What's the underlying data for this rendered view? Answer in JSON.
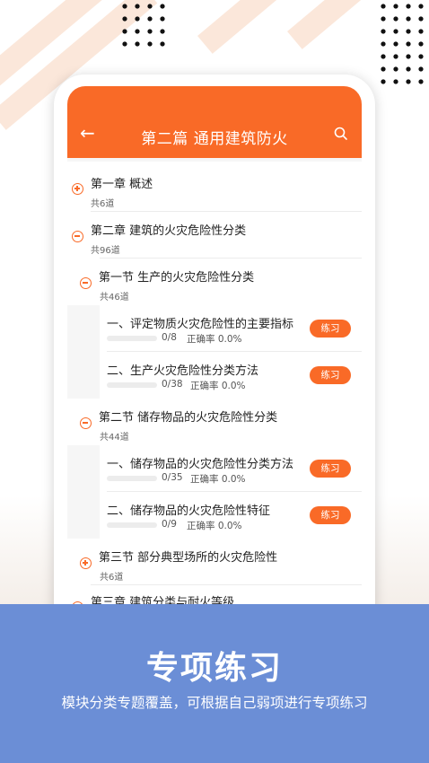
{
  "app_bar": {
    "back_icon": "arrow-left-icon",
    "title": "第二篇 通用建筑防火",
    "search_icon": "search-icon"
  },
  "colors": {
    "accent": "#f96a27",
    "banner": "#6b8ed6"
  },
  "chapters": [
    {
      "name": "第一章 概述",
      "count": "共6道",
      "expanded": false
    },
    {
      "name": "第二章 建筑的火灾危险性分类",
      "count": "共96道",
      "expanded": true
    }
  ],
  "sections": [
    {
      "name": "第一节 生产的火灾危险性分类",
      "count": "共46道",
      "expanded": true
    },
    {
      "name": "第二节 储存物品的火灾危险性分类",
      "count": "共44道",
      "expanded": true
    },
    {
      "name": "第三节 部分典型场所的火灾危险性",
      "count": "共6道",
      "expanded": false
    }
  ],
  "items": [
    {
      "name": "一、评定物质火灾危险性的主要指标",
      "progress": "0/8",
      "accuracy": "正确率 0.0%",
      "button": "练习"
    },
    {
      "name": "二、生产火灾危险性分类方法",
      "progress": "0/38",
      "accuracy": "正确率 0.0%",
      "button": "练习"
    },
    {
      "name": "一、储存物品的火灾危险性分类方法",
      "progress": "0/35",
      "accuracy": "正确率 0.0%",
      "button": "练习"
    },
    {
      "name": "二、储存物品的火灾危险性特征",
      "progress": "0/9",
      "accuracy": "正确率 0.0%",
      "button": "练习"
    }
  ],
  "next_chapter": {
    "name": "第三章 建筑分类与耐火等级"
  },
  "banner": {
    "title": "专项练习",
    "subtitle": "模块分类专题覆盖，可根据自己弱项进行专项练习"
  }
}
